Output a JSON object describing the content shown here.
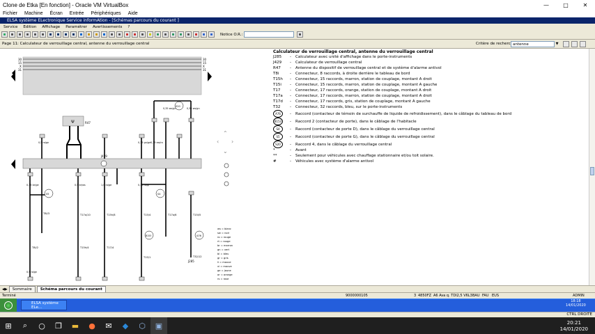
{
  "vbox": {
    "title": "Clone de Etka [En fonction] - Oracle VM VirtualBox",
    "menu": [
      "Fichier",
      "Machine",
      "Écran",
      "Entrée",
      "Périphériques",
      "Aide"
    ],
    "status_right": "CTRL DROITE"
  },
  "elsa": {
    "title": "ELSA système ELectronique Service informAtion - [Schémas parcours du courant ]",
    "menu": [
      "Service",
      "Edition",
      "Affichage",
      "Paramétrer",
      "Avertissements",
      "?"
    ],
    "notice_label": "Notice O.R.:",
    "notice_value": "",
    "page_title": "Page 11: Calculateur de verrouillage central, antenne du verrouillage central",
    "criteria_label": "Critère de recherche:",
    "criteria_value": "antenne",
    "tabs": [
      "Sommaire",
      "Schéma parcours du courant"
    ],
    "status": {
      "left": "Terminé",
      "order": "9000000105",
      "num": "3",
      "engine": "4850FZ",
      "vehicle": "A6 Ava q. TDI2,5 V6L3",
      "code1": "BAU",
      "code2": "FAU",
      "region": "EUS",
      "user": "ADMIN"
    }
  },
  "legend": {
    "title": "Calculateur de verrouillage central, antenne du verrouillage central",
    "rows": [
      {
        "code": "J285",
        "text": "Calculateur avec unité d'affichage dans le porte-instruments"
      },
      {
        "code": "J429",
        "text": "Calculateur de verrouillage central"
      },
      {
        "code": "R47",
        "text": "Antenne du dispositif de verrouillage central et de système d'alarme antivol"
      },
      {
        "code": "T8i",
        "text": "Connecteur, 8 raccords, à droite derrière le tableau de bord"
      },
      {
        "code": "T15h",
        "text": "Connecteur, 15 raccords, marron, station de couplage, montant A droit"
      },
      {
        "code": "T15i",
        "text": "Connecteur, 15 raccords, marron, station de couplage, montant A gauche"
      },
      {
        "code": "T17",
        "text": "Connecteur, 17 raccords, orange, station de couplage, montant A droit"
      },
      {
        "code": "T17a",
        "text": "Connecteur, 17 raccords, marron, station de couplage, montant A droit"
      },
      {
        "code": "T17d",
        "text": "Connecteur, 17 raccords, gris, station de couplage, montant A gauche"
      },
      {
        "code": "T32",
        "text": "Connecteur, 32 raccords, bleu, sur le porte-instruments"
      }
    ],
    "circ_rows": [
      {
        "code": "A76",
        "text": "Raccord (contacteur de témoin de surchauffe de liquide de refroidissement), dans le câblage du tableau de bord"
      },
      {
        "code": "B153",
        "text": "Raccord 2 (contacteur de porte), dans le câblage de l'habitacle"
      },
      {
        "code": "S4",
        "text": "Raccord (contacteur de porte D), dans le câblage du verrouillage central"
      },
      {
        "code": "S5",
        "text": "Raccord (contacteur de porte G), dans le câblage du verrouillage central"
      },
      {
        "code": "S20",
        "text": "Raccord 4, dans le câblage du verrouillage central"
      }
    ],
    "notes": [
      {
        "code": "*",
        "text": "Avant"
      },
      {
        "code": "**",
        "text": "Seulement pour véhicules avec chauffage stationnaire et/ou toit solaire."
      },
      {
        "code": "#",
        "text": "Véhicules avec système d'alarme antivol"
      }
    ]
  },
  "diagram": {
    "rails_left": [
      "30",
      "15",
      "X",
      "31"
    ],
    "rails_right": [
      "30",
      "15",
      "X",
      "31"
    ],
    "module_r47": "R47",
    "module_j429": "J429",
    "j285_label": "J285",
    "connectors": [
      "T8i/3",
      "T8i/2",
      "T17a/10",
      "T15h/4",
      "T15h/8",
      "T17/4",
      "T15/4",
      "T15/1",
      "T17a/6",
      "T15i/5",
      "T17d/15",
      "T17d/16",
      "T17d/4",
      "T15h/6",
      "T17/7",
      "T32/12"
    ],
    "wire_labels": [
      "0,5 ro/gn",
      "0,5 br/ws",
      "1,0 ro/ge",
      "0,35 gn/ge",
      "0,35 sw/ro",
      "0,35 ws/gn",
      "0,35 ws/gn",
      "1,0 ro/ge",
      "0,35 br/ge",
      "0,35 ro/gr",
      "0,5 br/ws",
      "0,5 ro/gn"
    ],
    "splice_labels": [
      "S20",
      "S5",
      "S4",
      "B153",
      "A76"
    ],
    "color_codes": [
      "ws = blanc",
      "sw = noir",
      "ro = rouge",
      "rt = rouge",
      "br = marron",
      "gn = vert",
      "bl = bleu",
      "gr = gris",
      "li = mauve",
      "vi = mauve",
      "ge = jaune",
      "or = orange",
      "rs = rose"
    ]
  },
  "guest_taskbar": {
    "item": "ELSA système ELe...",
    "time": "18:18",
    "date": "14/01/2020"
  },
  "host_taskbar": {
    "time": "20:21",
    "date": "14/01/2020"
  }
}
